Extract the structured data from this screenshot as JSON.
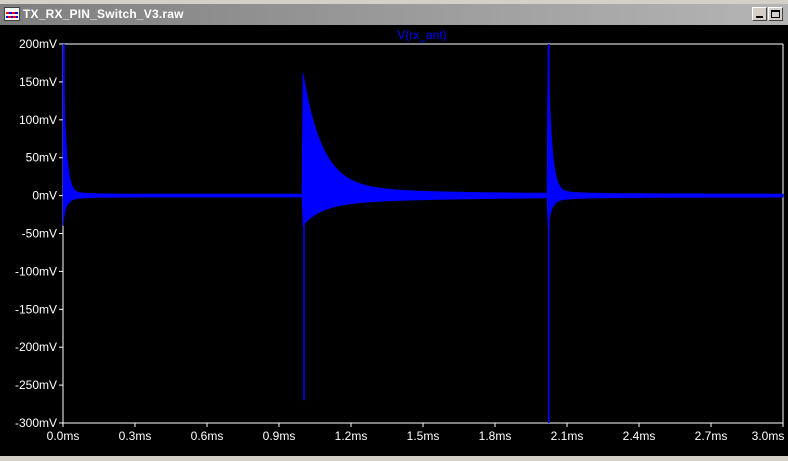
{
  "window": {
    "title": "TX_RX_PIN_Switch_V3.raw",
    "minimize_icon": "minimize-icon",
    "restore_icon": "restore-icon"
  },
  "colors": {
    "background": "#000000",
    "trace": "#0000ff",
    "axis_text": "#ffffff",
    "title_bar": "#8c8c8c"
  },
  "chart_data": {
    "type": "line",
    "title": "V(rx_ant)",
    "xlabel": "",
    "ylabel": "",
    "xlim": [
      0,
      3.0
    ],
    "ylim": [
      -300,
      200
    ],
    "x_unit": "ms",
    "y_unit": "mV",
    "x_ticks": [
      0.0,
      0.3,
      0.6,
      0.9,
      1.2,
      1.5,
      1.8,
      2.1,
      2.4,
      2.7,
      3.0
    ],
    "x_tick_labels": [
      "0.0ms",
      "0.3ms",
      "0.6ms",
      "0.9ms",
      "1.2ms",
      "1.5ms",
      "1.8ms",
      "2.1ms",
      "2.4ms",
      "2.7ms",
      "3.0ms"
    ],
    "y_ticks": [
      200,
      150,
      100,
      50,
      0,
      -50,
      -100,
      -150,
      -200,
      -250,
      -300
    ],
    "y_tick_labels": [
      "200mV",
      "150mV",
      "100mV",
      "50mV",
      "0mV",
      "-50mV",
      "-100mV",
      "-150mV",
      "-200mV",
      "-250mV",
      "-300mV"
    ],
    "grid": false,
    "series": [
      {
        "name": "V(rx_ant)",
        "events": [
          {
            "t": 0.0,
            "peak": 200,
            "trough": 0,
            "tau": 0.012,
            "ringing": 4
          },
          {
            "t": 1.0,
            "peak": 150,
            "trough": -270,
            "tau": 0.08,
            "ringing": 10
          },
          {
            "t": 2.02,
            "peak": 200,
            "trough": -300,
            "tau": 0.015,
            "ringing": 4
          }
        ],
        "baseline": 0,
        "steady_ripple": 4
      }
    ]
  }
}
